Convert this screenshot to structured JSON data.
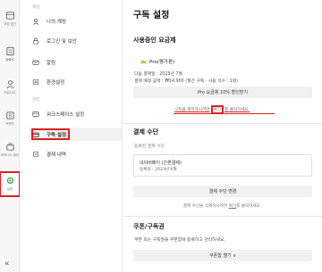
{
  "rail": {
    "items": [
      {
        "label": "작업 공간",
        "icon": "home-icon"
      },
      {
        "label": "템플릿",
        "icon": "template-icon"
      },
      {
        "label": "커뮤니티",
        "icon": "community-icon"
      },
      {
        "label": "브랜드",
        "icon": "brand-icon"
      },
      {
        "label": "비즈니스 센터",
        "icon": "business-icon"
      },
      {
        "label": "설정",
        "icon": "gear-icon"
      }
    ]
  },
  "menu": {
    "section_personal": "계정",
    "section_manage": "관리",
    "items": [
      {
        "label": "나의 계정"
      },
      {
        "label": "로그인 및 보안"
      },
      {
        "label": "알림"
      },
      {
        "label": "환경설정"
      },
      {
        "label": "워크스페이스 설정"
      },
      {
        "label": "구독 설정"
      },
      {
        "label": "결제 내역"
      }
    ]
  },
  "main": {
    "title": "구독 설정",
    "current_plan": {
      "heading": "사용중인 요금제",
      "plan_name": "Pro(평가판)",
      "next_payment": "다음 결제일 : 2023년 7월",
      "payment_amount": "결제 예정 금액 : ₩14,900 (월간 구독 · 사용 석수 : 1명)",
      "discount_button": "Pro 요금제 10% 할인받기",
      "cancel_prefix": "구독을 해지하시려면",
      "cancel_link": "여기",
      "cancel_suffix": "를 클릭하세요."
    },
    "payment": {
      "heading": "결제 수단",
      "registered_label": "등록된 결제 수단",
      "method_name": "네이버페이 (간편결제)",
      "method_date": "등록일 : 2023년 6월",
      "change_button": "결제 수단 변경",
      "delete_prefix": "결제 수단을 삭제하시려면",
      "delete_link": "여기",
      "delete_suffix": "를 클릭하세요."
    },
    "coupon": {
      "heading": "쿠폰/구독권",
      "description": "쿠폰 또는 구독권을 쿠폰함에 등록하고 관리하세요.",
      "open_button": "쿠폰함 열기 ∨"
    }
  }
}
